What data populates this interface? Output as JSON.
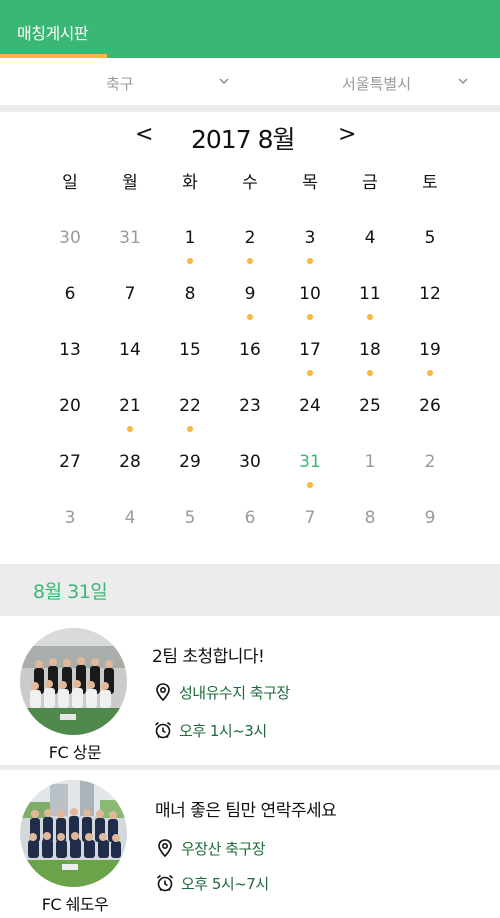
{
  "header": {
    "title": "매칭게시판"
  },
  "filters": {
    "sport": {
      "label": "축구"
    },
    "region": {
      "label": "서울특별시"
    }
  },
  "calendar": {
    "prev_label": "<",
    "next_label": ">",
    "title": "2017 8월",
    "weekdays": [
      "일",
      "월",
      "화",
      "수",
      "목",
      "금",
      "토"
    ],
    "weeks": [
      [
        {
          "d": "30",
          "m": true
        },
        {
          "d": "31",
          "m": true
        },
        {
          "d": "1",
          "dot": true
        },
        {
          "d": "2",
          "dot": true
        },
        {
          "d": "3",
          "dot": true
        },
        {
          "d": "4"
        },
        {
          "d": "5"
        }
      ],
      [
        {
          "d": "6"
        },
        {
          "d": "7"
        },
        {
          "d": "8"
        },
        {
          "d": "9",
          "dot": true
        },
        {
          "d": "10",
          "dot": true
        },
        {
          "d": "11",
          "dot": true
        },
        {
          "d": "12"
        }
      ],
      [
        {
          "d": "13"
        },
        {
          "d": "14"
        },
        {
          "d": "15"
        },
        {
          "d": "16"
        },
        {
          "d": "17",
          "dot": true
        },
        {
          "d": "18",
          "dot": true
        },
        {
          "d": "19",
          "dot": true
        }
      ],
      [
        {
          "d": "20"
        },
        {
          "d": "21",
          "dot": true
        },
        {
          "d": "22",
          "dot": true
        },
        {
          "d": "23"
        },
        {
          "d": "24"
        },
        {
          "d": "25"
        },
        {
          "d": "26"
        }
      ],
      [
        {
          "d": "27"
        },
        {
          "d": "28"
        },
        {
          "d": "29"
        },
        {
          "d": "30"
        },
        {
          "d": "31",
          "dot": true,
          "selected": true
        },
        {
          "d": "1",
          "m": true
        },
        {
          "d": "2",
          "m": true
        }
      ],
      [
        {
          "d": "3",
          "m": true
        },
        {
          "d": "4",
          "m": true
        },
        {
          "d": "5",
          "m": true
        },
        {
          "d": "6",
          "m": true
        },
        {
          "d": "7",
          "m": true
        },
        {
          "d": "8",
          "m": true
        },
        {
          "d": "9",
          "m": true
        }
      ]
    ]
  },
  "selected_date": {
    "label": "8월 31일"
  },
  "matches": [
    {
      "team": "FC 상문",
      "title": "2팀 초청합니다!",
      "location": "성내유수지 축구장",
      "time": "오후 1시~3시",
      "avatar_icon": "team-photo-icon"
    },
    {
      "team": "FC 쉐도우",
      "title": "매너 좋은 팀만 연락주세요",
      "location": "우장산 축구장",
      "time": "오후 5시~7시",
      "avatar_icon": "team-photo-icon"
    }
  ],
  "colors": {
    "brand": "#3bb775",
    "accent": "#f6b93b",
    "info_text": "#1d6b3a",
    "muted": "#9a9a9a"
  }
}
